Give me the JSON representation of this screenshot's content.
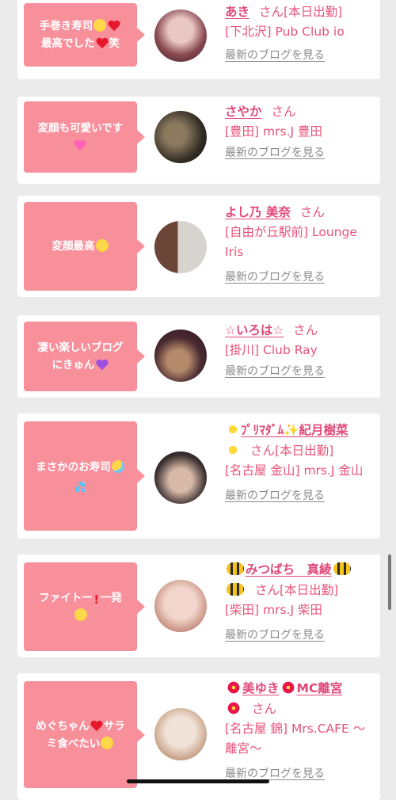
{
  "cards": [
    {
      "bubble_lines": [
        "手巻き寿司",
        "最高でした",
        "笑"
      ],
      "name": "あき",
      "san": "さん",
      "status": "[本日出勤]",
      "shop": "[下北沢] Pub Club io",
      "blog_link": "最新のブログを見る",
      "avatar_colors": [
        "#8a4a52",
        "#e9c7c2"
      ]
    },
    {
      "bubble_lines": [
        "変顔も可愛いです"
      ],
      "name": "さやか",
      "san": "さん",
      "status": "",
      "shop": "[豊田] mrs.J 豊田",
      "blog_link": "最新のブログを見る",
      "avatar_colors": [
        "#2f2a22",
        "#8c7a5f"
      ]
    },
    {
      "bubble_lines": [
        "変顔最高"
      ],
      "name": "よし乃 美奈",
      "san": "さん",
      "status": "",
      "shop": "[自由が丘駅前] Lounge Iris",
      "blog_link": "最新のブログを見る",
      "avatar_colors": [
        "#6b4638",
        "#d7d3cf"
      ]
    },
    {
      "bubble_lines": [
        "凄い楽しいブログ",
        "にきゅん"
      ],
      "name": "☆いろは☆",
      "san": "さん",
      "status": "",
      "shop": "[掛川] Club Ray",
      "blog_link": "最新のブログを見る",
      "avatar_colors": [
        "#4a2a32",
        "#b58a6a"
      ]
    },
    {
      "bubble_lines": [
        "まさかのお寿司"
      ],
      "name": "ﾌﾟﾘﾏﾀﾞﾑ✨紀月樹菜",
      "san": "さん",
      "status": "[本日出勤]",
      "shop": "[名古屋 金山] mrs.J 金山",
      "blog_link": "最新のブログを見る",
      "avatar_colors": [
        "#3b3030",
        "#d8b9a8"
      ]
    },
    {
      "bubble_lines": [
        "ファイトー",
        "一発"
      ],
      "name": "みつばち　真綾",
      "san": "さん",
      "status": "[本日出勤]",
      "shop": "[柴田] mrs.J 柴田",
      "blog_link": "最新のブログを見る",
      "avatar_colors": [
        "#c48a7a",
        "#f2d6cc"
      ]
    },
    {
      "bubble_lines": [
        "めぐちゃん",
        "サラ",
        "ミ食べたい"
      ],
      "name": "美ゆき",
      "name_suffix": "MC離宮",
      "san": "さん",
      "status": "",
      "shop": "[名古屋 錦] Mrs.CAFE ～離宮～",
      "blog_link": "最新のブログを見る",
      "avatar_colors": [
        "#c9a48a",
        "#f1e2d8"
      ]
    }
  ],
  "colors": {
    "bubble": "#f8909c",
    "name": "#e04878",
    "text": "#e8537a",
    "link": "#8a8a8a",
    "background": "#ebebeb"
  }
}
